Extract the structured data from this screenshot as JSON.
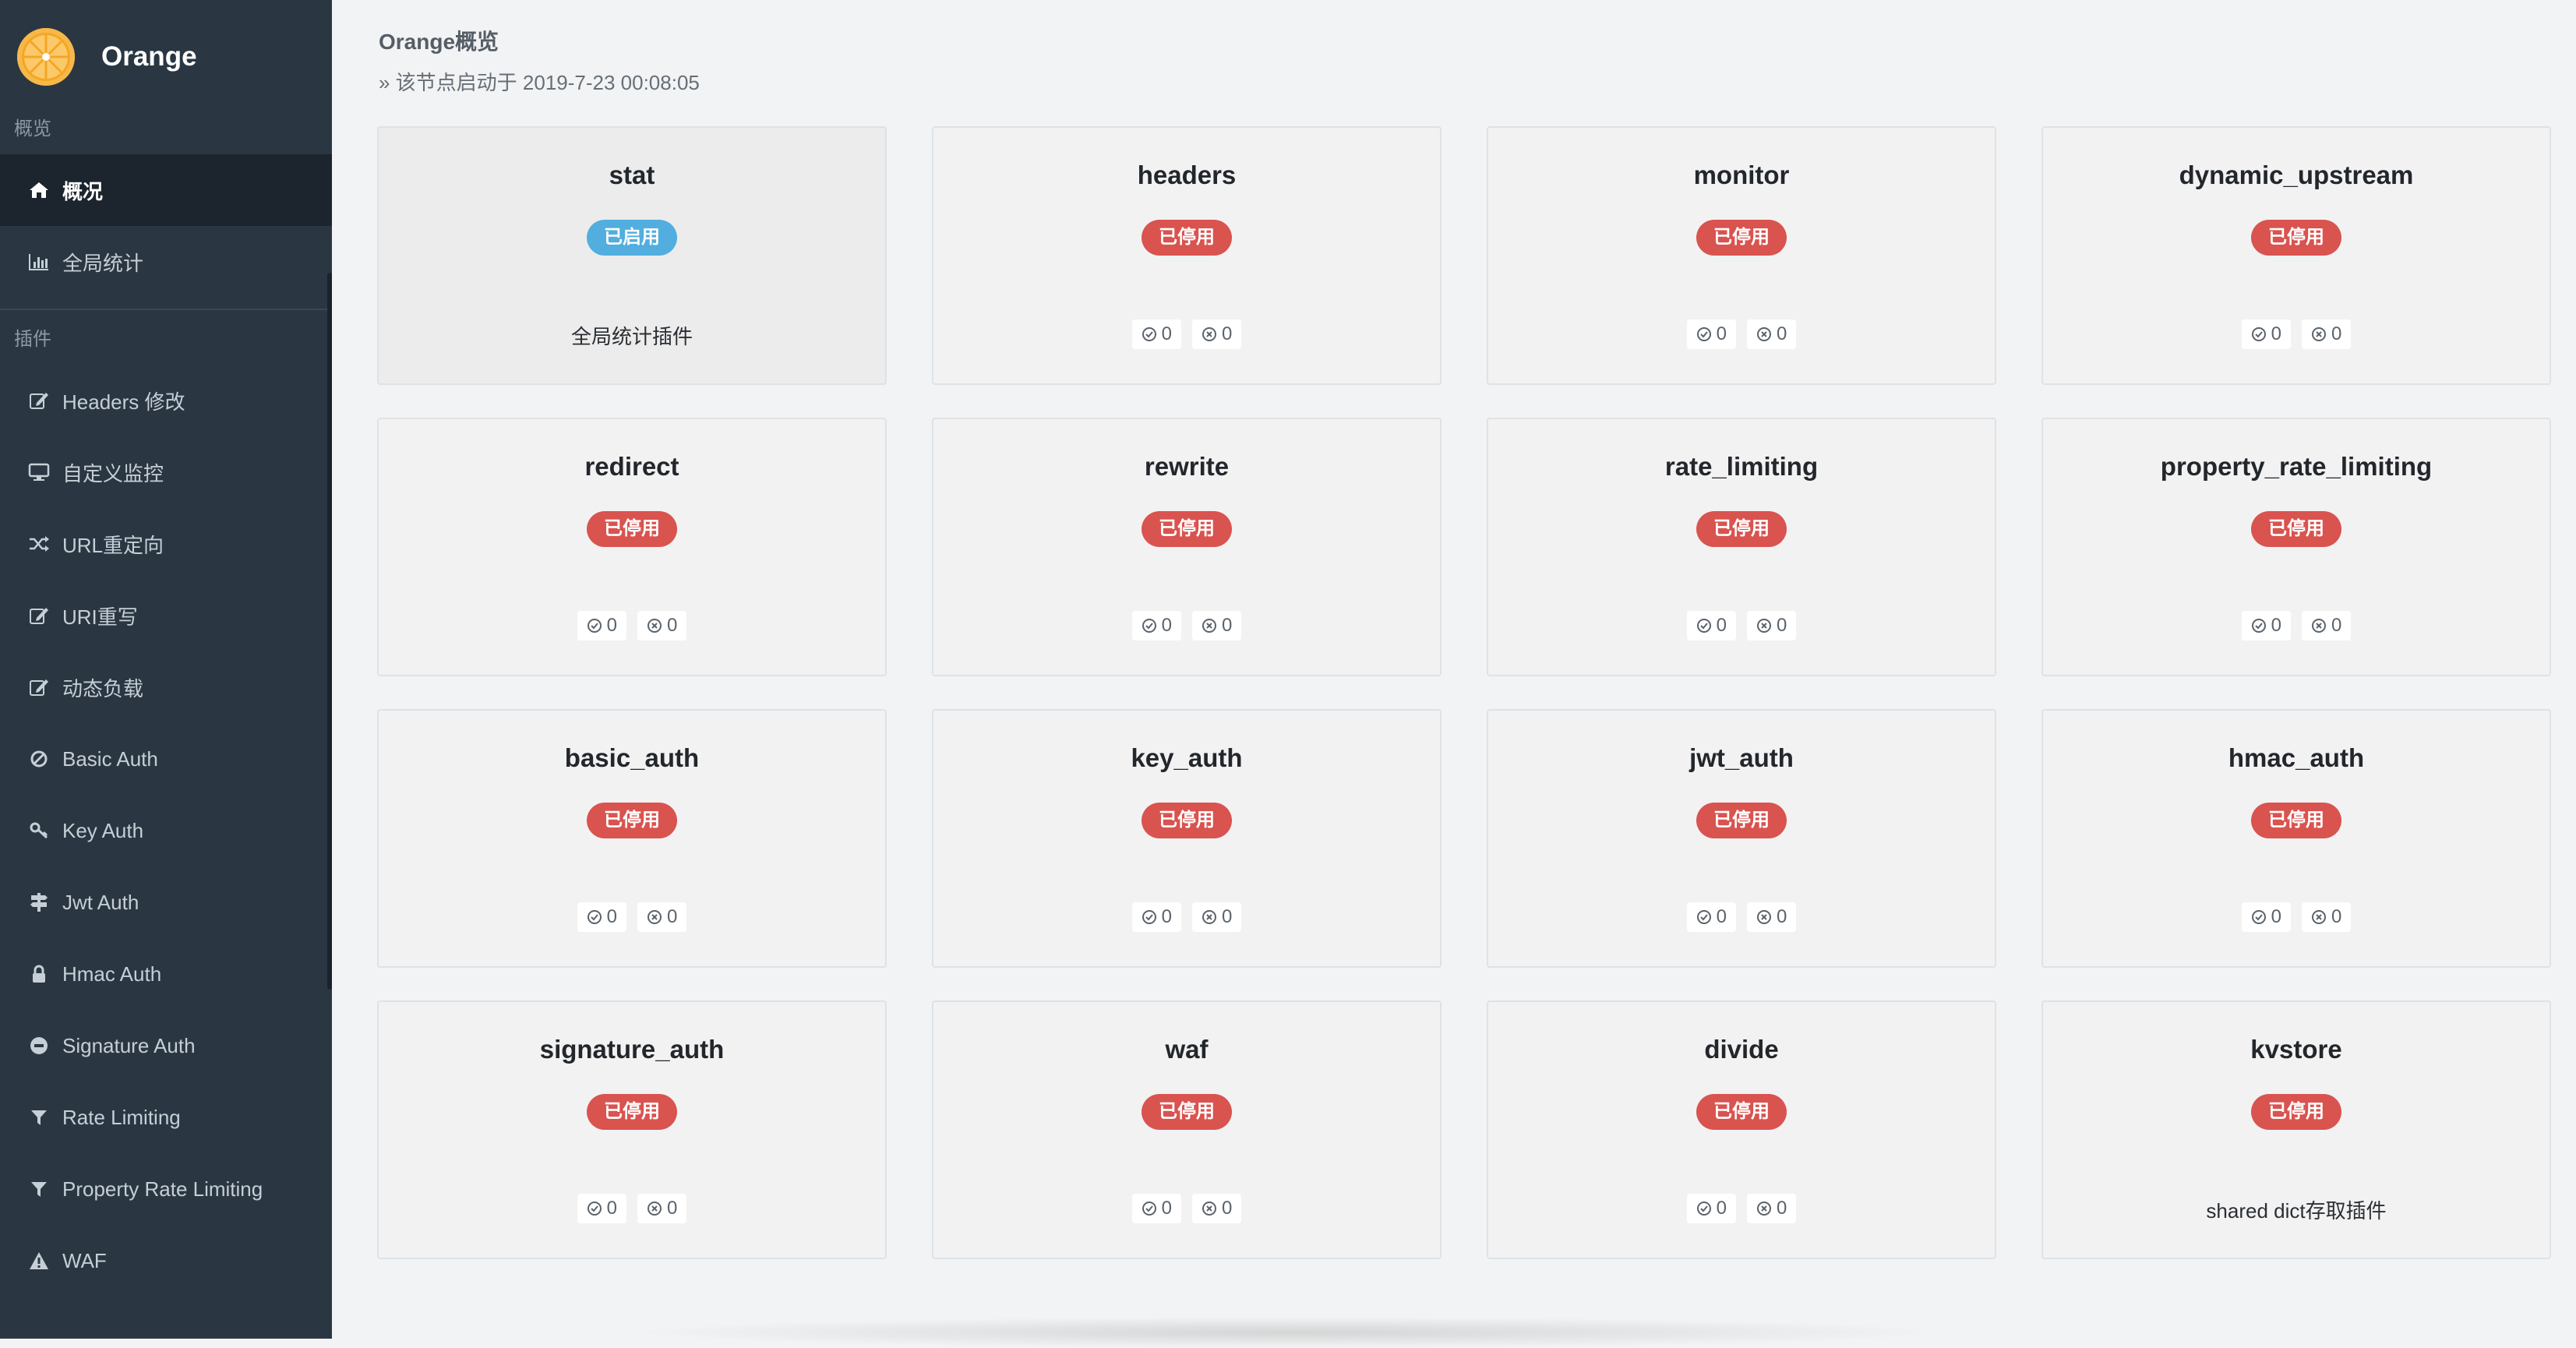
{
  "brand": {
    "name": "Orange"
  },
  "sidebar": {
    "section_overview": "概览",
    "section_plugins": "插件",
    "overview_items": [
      {
        "label": "概况",
        "icon": "home-icon",
        "active": true
      },
      {
        "label": "全局统计",
        "icon": "bar-chart-icon",
        "active": false
      }
    ],
    "plugin_items": [
      {
        "label": "Headers 修改",
        "icon": "edit-icon"
      },
      {
        "label": "自定义监控",
        "icon": "desktop-icon"
      },
      {
        "label": "URL重定向",
        "icon": "random-icon"
      },
      {
        "label": "URI重写",
        "icon": "edit-icon"
      },
      {
        "label": "动态负载",
        "icon": "edit-icon"
      },
      {
        "label": "Basic Auth",
        "icon": "ban-icon"
      },
      {
        "label": "Key Auth",
        "icon": "key-icon"
      },
      {
        "label": "Jwt Auth",
        "icon": "signpost-icon"
      },
      {
        "label": "Hmac Auth",
        "icon": "lock-icon"
      },
      {
        "label": "Signature Auth",
        "icon": "minus-circle-icon"
      },
      {
        "label": "Rate Limiting",
        "icon": "filter-icon"
      },
      {
        "label": "Property Rate Limiting",
        "icon": "filter-icon"
      },
      {
        "label": "WAF",
        "icon": "warning-icon"
      }
    ]
  },
  "header": {
    "title": "Orange概览",
    "subtitle": "» 该节点启动于 2019-7-23 00:08:05"
  },
  "status_labels": {
    "enabled": "已启用",
    "disabled": "已停用"
  },
  "colors": {
    "enabled": "#52aede",
    "disabled": "#d9534f",
    "sidebar": "#2a3742"
  },
  "plugins": [
    {
      "name": "stat",
      "status": "已启用",
      "enabled": true,
      "desc": "全局统计插件"
    },
    {
      "name": "headers",
      "status": "已停用",
      "enabled": false,
      "ok": "0",
      "err": "0"
    },
    {
      "name": "monitor",
      "status": "已停用",
      "enabled": false,
      "ok": "0",
      "err": "0"
    },
    {
      "name": "dynamic_upstream",
      "status": "已停用",
      "enabled": false,
      "ok": "0",
      "err": "0"
    },
    {
      "name": "redirect",
      "status": "已停用",
      "enabled": false,
      "ok": "0",
      "err": "0"
    },
    {
      "name": "rewrite",
      "status": "已停用",
      "enabled": false,
      "ok": "0",
      "err": "0"
    },
    {
      "name": "rate_limiting",
      "status": "已停用",
      "enabled": false,
      "ok": "0",
      "err": "0"
    },
    {
      "name": "property_rate_limiting",
      "status": "已停用",
      "enabled": false,
      "ok": "0",
      "err": "0"
    },
    {
      "name": "basic_auth",
      "status": "已停用",
      "enabled": false,
      "ok": "0",
      "err": "0"
    },
    {
      "name": "key_auth",
      "status": "已停用",
      "enabled": false,
      "ok": "0",
      "err": "0"
    },
    {
      "name": "jwt_auth",
      "status": "已停用",
      "enabled": false,
      "ok": "0",
      "err": "0"
    },
    {
      "name": "hmac_auth",
      "status": "已停用",
      "enabled": false,
      "ok": "0",
      "err": "0"
    },
    {
      "name": "signature_auth",
      "status": "已停用",
      "enabled": false,
      "ok": "0",
      "err": "0"
    },
    {
      "name": "waf",
      "status": "已停用",
      "enabled": false,
      "ok": "0",
      "err": "0"
    },
    {
      "name": "divide",
      "status": "已停用",
      "enabled": false,
      "ok": "0",
      "err": "0"
    },
    {
      "name": "kvstore",
      "status": "已停用",
      "enabled": false,
      "desc": "shared dict存取插件"
    }
  ]
}
